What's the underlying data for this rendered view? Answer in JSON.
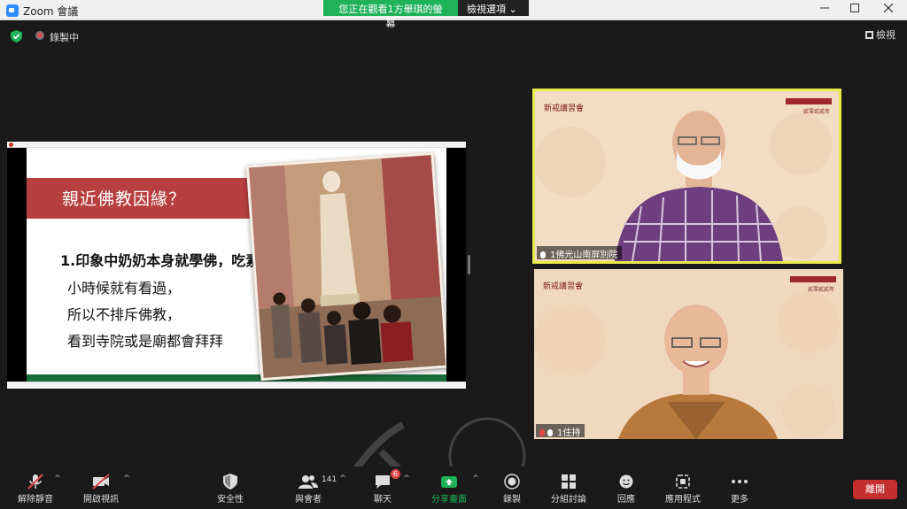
{
  "window": {
    "title": "Zoom 會議"
  },
  "banner": {
    "viewing": "您正在觀看1方舉琪的螢幕",
    "view_options": "檢視選項"
  },
  "top": {
    "recording": "錄製中",
    "view": "檢視"
  },
  "share": {
    "heading": "親近佛教因緣？",
    "bullets": [
      "1.印象中奶奶本身就學佛，吃素，",
      "小時候就有看過，",
      "所以不排斥佛教，",
      "看到寺院或是廟都會拜拜"
    ]
  },
  "participants": [
    {
      "name": "1佛光山南屏別院",
      "org_title": "新戒講習會",
      "org_sub": "貳零貳貳年"
    },
    {
      "name": "1住持",
      "org_title": "新戒講習會",
      "org_sub": "貳零貳貳年"
    }
  ],
  "toolbar": {
    "unmute": "解除靜音",
    "video": "開啟視訊",
    "security": "安全性",
    "participants": "與會者",
    "participant_count": "141",
    "chat": "聊天",
    "chat_badge": "6",
    "share": "分享畫面",
    "record": "錄製",
    "breakout": "分組討論",
    "reactions": "回應",
    "apps": "應用程式",
    "more": "更多",
    "leave": "離開"
  },
  "colors": {
    "share_green": "#1fb25a",
    "leave_red": "#c62f2f",
    "active_speaker": "#e8e94a"
  }
}
